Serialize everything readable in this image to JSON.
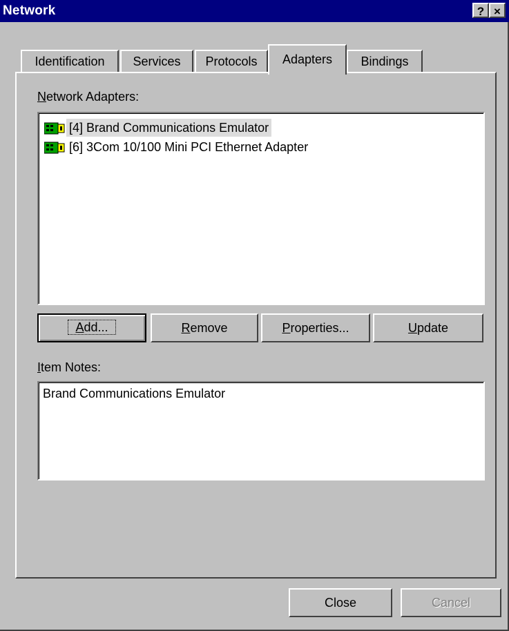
{
  "window": {
    "title": "Network",
    "help_glyph": "?",
    "close_glyph": "×"
  },
  "tabs": [
    {
      "label": "Identification"
    },
    {
      "label": "Services"
    },
    {
      "label": "Protocols"
    },
    {
      "label": "Adapters",
      "active": true
    },
    {
      "label": "Bindings"
    }
  ],
  "adapters_panel": {
    "list_label_hotkey": "N",
    "list_label_rest": "etwork Adapters:",
    "items": [
      {
        "label": "[4] Brand Communications Emulator",
        "selected": true
      },
      {
        "label": "[6] 3Com 10/100 Mini PCI Ethernet Adapter",
        "selected": false
      }
    ],
    "buttons": {
      "add_hotkey": "A",
      "add_rest": "dd...",
      "remove_hotkey": "R",
      "remove_rest": "emove",
      "properties_hotkey": "P",
      "properties_rest": "roperties...",
      "update_hotkey": "U",
      "update_rest": "pdate"
    },
    "notes_label_hotkey": "I",
    "notes_label_rest": "tem Notes:",
    "notes_text": "Brand Communications Emulator"
  },
  "footer": {
    "close_label": "Close",
    "cancel_label": "Cancel"
  },
  "colors": {
    "titlebar": "#000080",
    "face": "#c0c0c0",
    "icon_green": "#00a000"
  }
}
